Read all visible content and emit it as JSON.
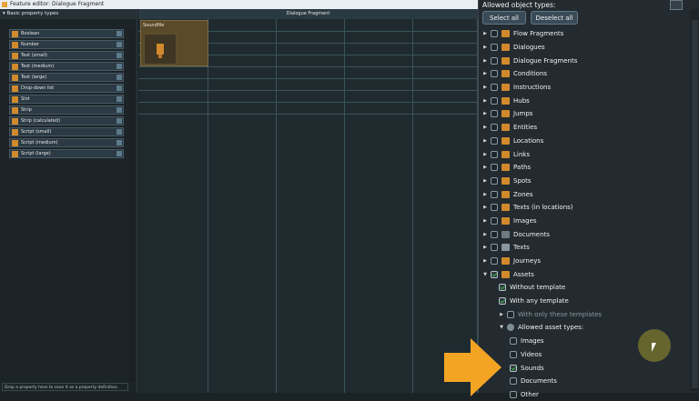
{
  "window": {
    "title": "Feature editor: Dialogue Fragment"
  },
  "left_panel": {
    "section": "Basic property types",
    "properties": [
      "Boolean",
      "Number",
      "Text (small)",
      "Text (medium)",
      "Text (large)",
      "Drop-down list",
      "Slot",
      "Strip",
      "Strip (calculated)",
      "Script (small)",
      "Script (medium)",
      "Script (large)"
    ],
    "hint": "Drop a property here to save it as a property definition."
  },
  "canvas": {
    "header": "Dialogue Fragment",
    "tile_label": "Soundfile"
  },
  "right_panel": {
    "title": "Allowed object types:",
    "select_all": "Select all",
    "deselect_all": "Deselect all",
    "object_types": [
      {
        "label": "Flow Fragments",
        "icon": "flow-fragment-icon",
        "checked": false
      },
      {
        "label": "Dialogues",
        "icon": "dialogue-icon",
        "checked": false
      },
      {
        "label": "Dialogue Fragments",
        "icon": "dialogue-fragment-icon",
        "checked": false
      },
      {
        "label": "Conditions",
        "icon": "condition-icon",
        "checked": false
      },
      {
        "label": "Instructions",
        "icon": "instruction-icon",
        "checked": false
      },
      {
        "label": "Hubs",
        "icon": "hub-icon",
        "checked": false
      },
      {
        "label": "Jumps",
        "icon": "jump-icon",
        "checked": false
      },
      {
        "label": "Entities",
        "icon": "entity-icon",
        "checked": false
      },
      {
        "label": "Locations",
        "icon": "location-icon",
        "checked": false
      },
      {
        "label": "Links",
        "icon": "link-icon",
        "checked": false
      },
      {
        "label": "Paths",
        "icon": "path-icon",
        "checked": false
      },
      {
        "label": "Spots",
        "icon": "spot-icon",
        "checked": false
      },
      {
        "label": "Zones",
        "icon": "zone-icon",
        "checked": false
      },
      {
        "label": "Texts (in locations)",
        "icon": "text-location-icon",
        "checked": false
      },
      {
        "label": "Images",
        "icon": "image-icon",
        "checked": false
      },
      {
        "label": "Documents",
        "icon": "document-icon",
        "checked": false
      },
      {
        "label": "Texts",
        "icon": "text-icon",
        "checked": false
      },
      {
        "label": "Journeys",
        "icon": "journey-icon",
        "checked": false
      },
      {
        "label": "Assets",
        "icon": "asset-icon",
        "checked": true
      }
    ],
    "assets_sub": {
      "without_template": "Without template",
      "with_any_template": "With any template",
      "with_only_these": "With only these templates",
      "allowed_asset_types": "Allowed asset types:",
      "asset_types": [
        {
          "label": "Images",
          "checked": false
        },
        {
          "label": "Videos",
          "checked": false
        },
        {
          "label": "Sounds",
          "checked": true
        },
        {
          "label": "Documents",
          "checked": false
        },
        {
          "label": "Other",
          "checked": false
        }
      ]
    }
  },
  "colors": {
    "accent_arrow": "#f4a423",
    "check_green": "#3bb34a",
    "panel_bg": "#232b30"
  }
}
